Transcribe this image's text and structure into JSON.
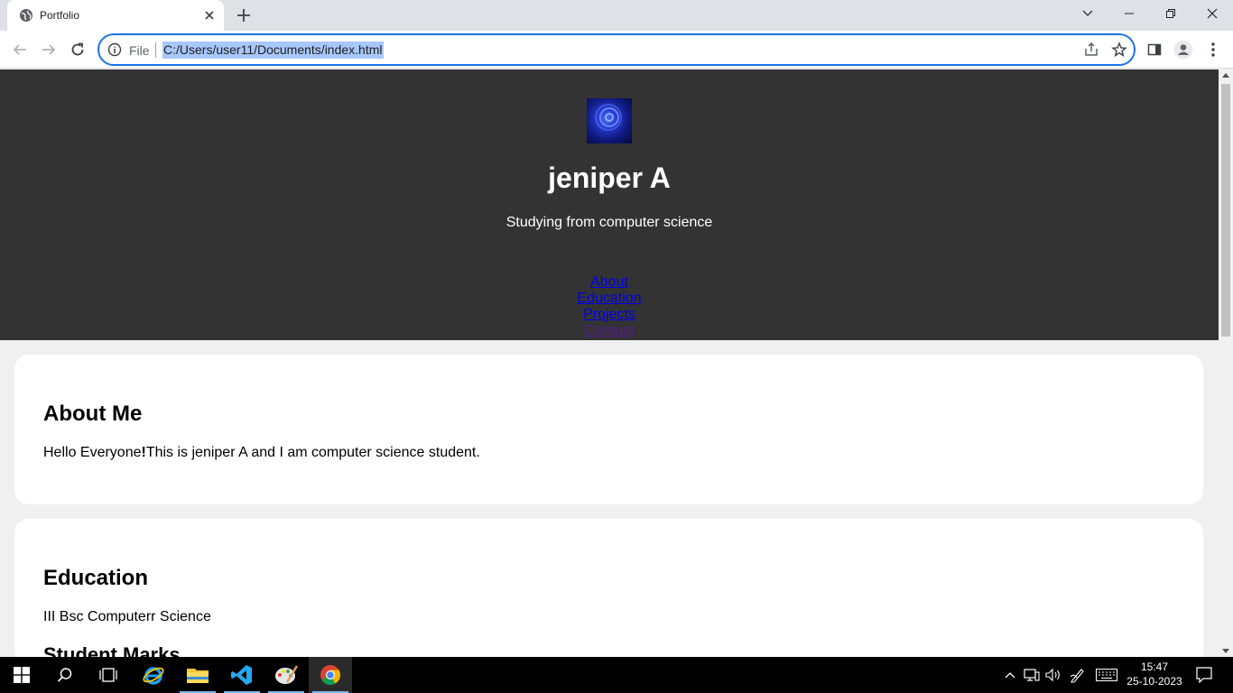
{
  "browser": {
    "tab_title": "Portfolio",
    "omnibox_scheme": "File",
    "url": "C:/Users/user11/Documents/index.html"
  },
  "page": {
    "name": "jeniper A",
    "tagline": "Studying from computer science",
    "nav": [
      "About",
      "Education",
      "Projects",
      "Contact"
    ],
    "about": {
      "heading": "About Me",
      "text_prefix": "Hello Everyone",
      "text_exclaim": "!",
      "text_rest": "This is jeniper A and I am computer science student."
    },
    "education": {
      "heading": "Education",
      "degree": "III Bsc Computerr Science",
      "subheading": "Student Marks"
    }
  },
  "taskbar": {
    "time": "15:47",
    "date": "25-10-2023"
  },
  "colors": {
    "header_bg": "#333333",
    "link": "#0000ee",
    "visited_link": "#551a8b",
    "omnibox_focus": "#1a73e8"
  }
}
